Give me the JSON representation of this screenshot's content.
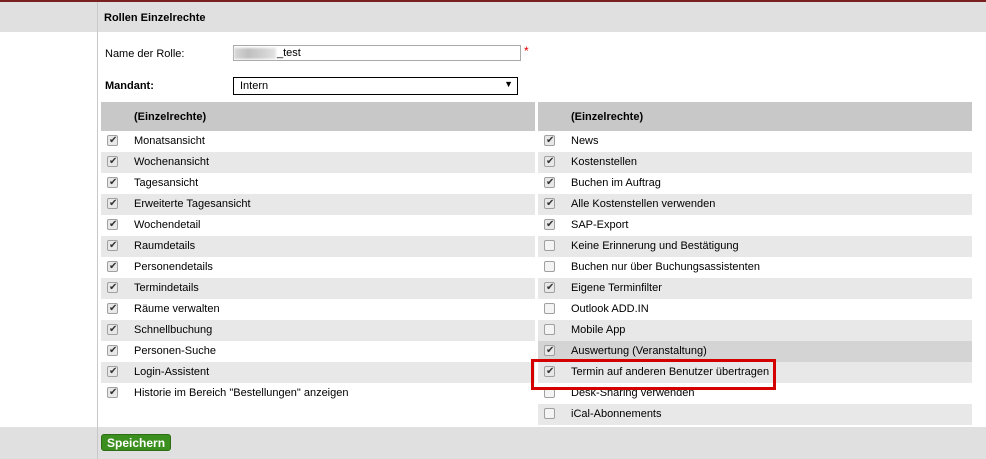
{
  "section_title": "Rollen Einzelrechte",
  "role_name": {
    "label": "Name der Rolle:",
    "value": "_test",
    "required_mark": "*"
  },
  "mandant": {
    "label": "Mandant:",
    "selected": "Intern"
  },
  "left_column": {
    "header": "(Einzelrechte)",
    "items": [
      {
        "label": "Monatsansicht",
        "checked": true
      },
      {
        "label": "Wochenansicht",
        "checked": true
      },
      {
        "label": "Tagesansicht",
        "checked": true
      },
      {
        "label": "Erweiterte Tagesansicht",
        "checked": true
      },
      {
        "label": "Wochendetail",
        "checked": true
      },
      {
        "label": "Raumdetails",
        "checked": true
      },
      {
        "label": "Personendetails",
        "checked": true
      },
      {
        "label": "Termindetails",
        "checked": true
      },
      {
        "label": "Räume verwalten",
        "checked": true
      },
      {
        "label": "Schnellbuchung",
        "checked": true
      },
      {
        "label": "Personen-Suche",
        "checked": true
      },
      {
        "label": "Login-Assistent",
        "checked": true
      },
      {
        "label": "Historie im Bereich \"Bestellungen\" anzeigen",
        "checked": true
      }
    ]
  },
  "right_column": {
    "header": "(Einzelrechte)",
    "items": [
      {
        "label": "News",
        "checked": true
      },
      {
        "label": "Kostenstellen",
        "checked": true
      },
      {
        "label": "Buchen im Auftrag",
        "checked": true
      },
      {
        "label": "Alle Kostenstellen verwenden",
        "checked": true
      },
      {
        "label": "SAP-Export",
        "checked": true
      },
      {
        "label": "Keine Erinnerung und Bestätigung",
        "checked": false
      },
      {
        "label": "Buchen nur über Buchungsassistenten",
        "checked": false
      },
      {
        "label": "Eigene Terminfilter",
        "checked": true
      },
      {
        "label": "Outlook ADD.IN",
        "checked": false
      },
      {
        "label": "Mobile App",
        "checked": false
      },
      {
        "label": "Auswertung (Veranstaltung)",
        "checked": true
      },
      {
        "label": "Termin auf anderen Benutzer übertragen",
        "checked": true
      },
      {
        "label": "Desk-Sharing verwenden",
        "checked": false
      },
      {
        "label": "iCal-Abonnements",
        "checked": false
      }
    ]
  },
  "save_button": "Speichern",
  "colors": {
    "accent_green": "#3b8f1f",
    "highlight_red": "#d40000",
    "top_line": "#7a1f1f"
  },
  "icons": {
    "checkbox_checked": "checkmark-icon",
    "select_arrow": "triangle-down-icon"
  }
}
